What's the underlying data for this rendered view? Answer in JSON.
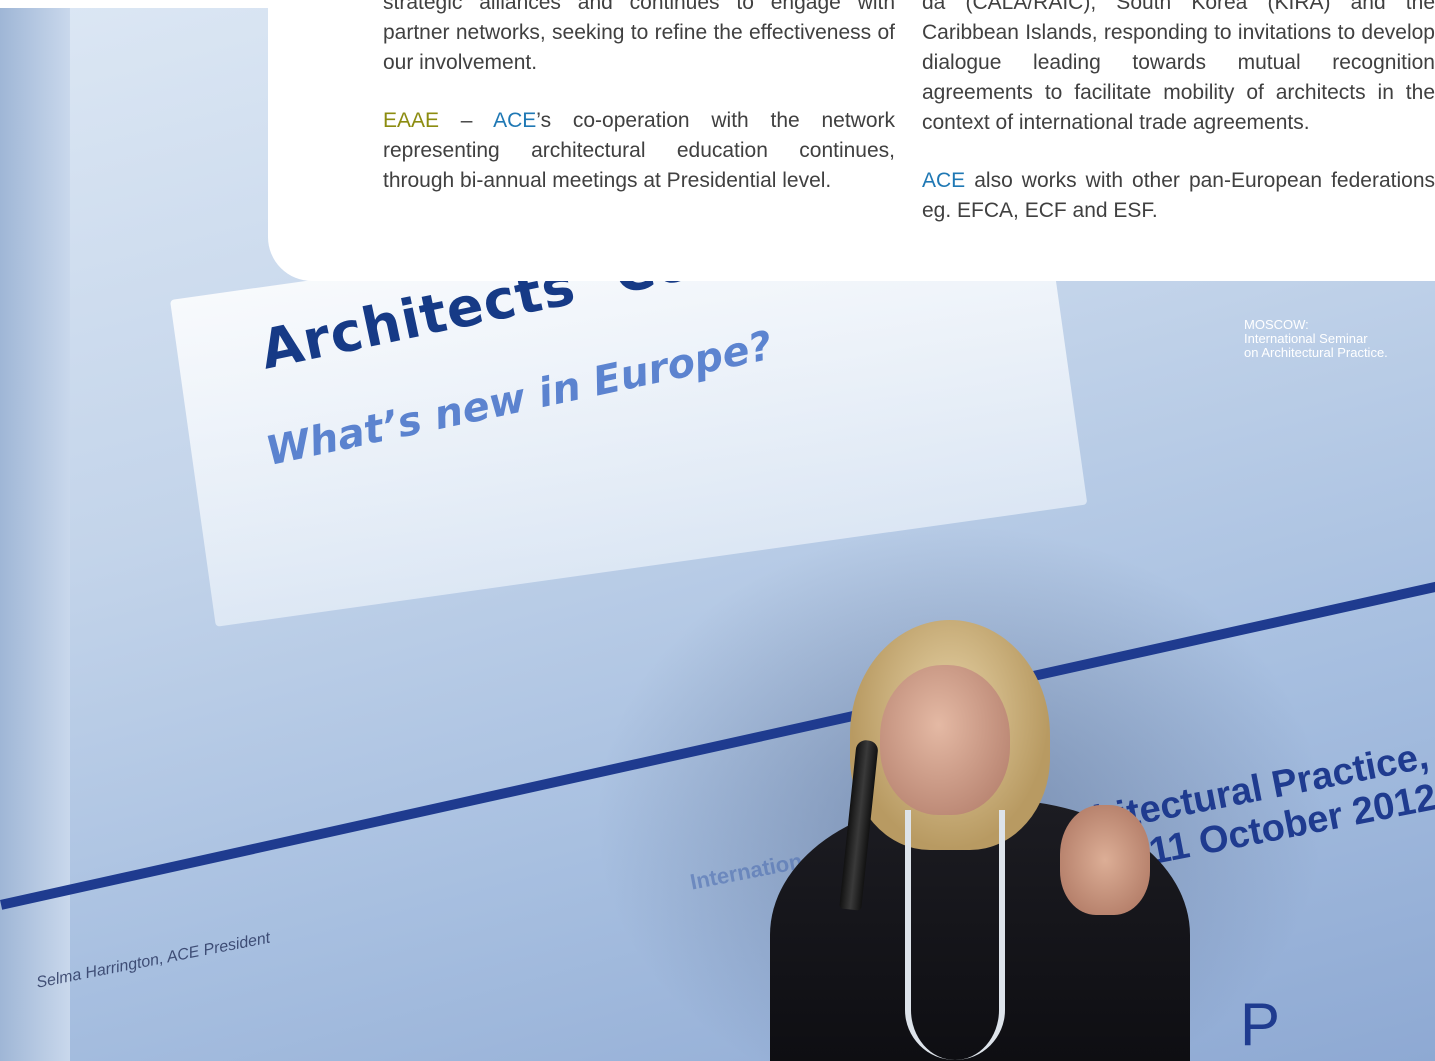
{
  "page": {
    "left_column": {
      "p1_lines": [
        "strategic alliances and continues to engage with",
        "partner networks, seeking to refine the effectiveness",
        "of our involvement."
      ],
      "p2_org1": "EAAE",
      "p2_dash": " – ",
      "p2_org2": "ACE",
      "p2_rest": "’s co-operation with the network representing architectural education continues, through bi-annual meetings at Presidential level."
    },
    "right_column": {
      "p1_lines": [
        "da (CALA/RAIC), South Korea (KIRA) and the Caribbean Islands, responding to invitations to develop dialogue leading towards mutual recognition agreements to facilitate mobility of architects in the context of international trade agreements."
      ],
      "p2_org": "ACE",
      "p2_rest": " also works with other pan-European federations eg. EFCA, ECF and ESF."
    },
    "caption": {
      "line1": "MOSCOW:",
      "line2": "International Seminar",
      "line3": "on Architectural Practice."
    },
    "photo": {
      "slide_title": "Architects’ Council of Europe",
      "slide_subtitle": "What’s new in Europe?",
      "slide_footer": "Selma Harrington, ACE President",
      "slide_intl": "Internation",
      "slide_practice_line1": "hitectural Practice,",
      "slide_practice_line2": "11 October 2012",
      "slide_letters": "P X"
    },
    "colors": {
      "accent_olive": "#8c8c10",
      "accent_blue": "#1f78b4",
      "slide_blue": "#1f3b8f"
    }
  }
}
